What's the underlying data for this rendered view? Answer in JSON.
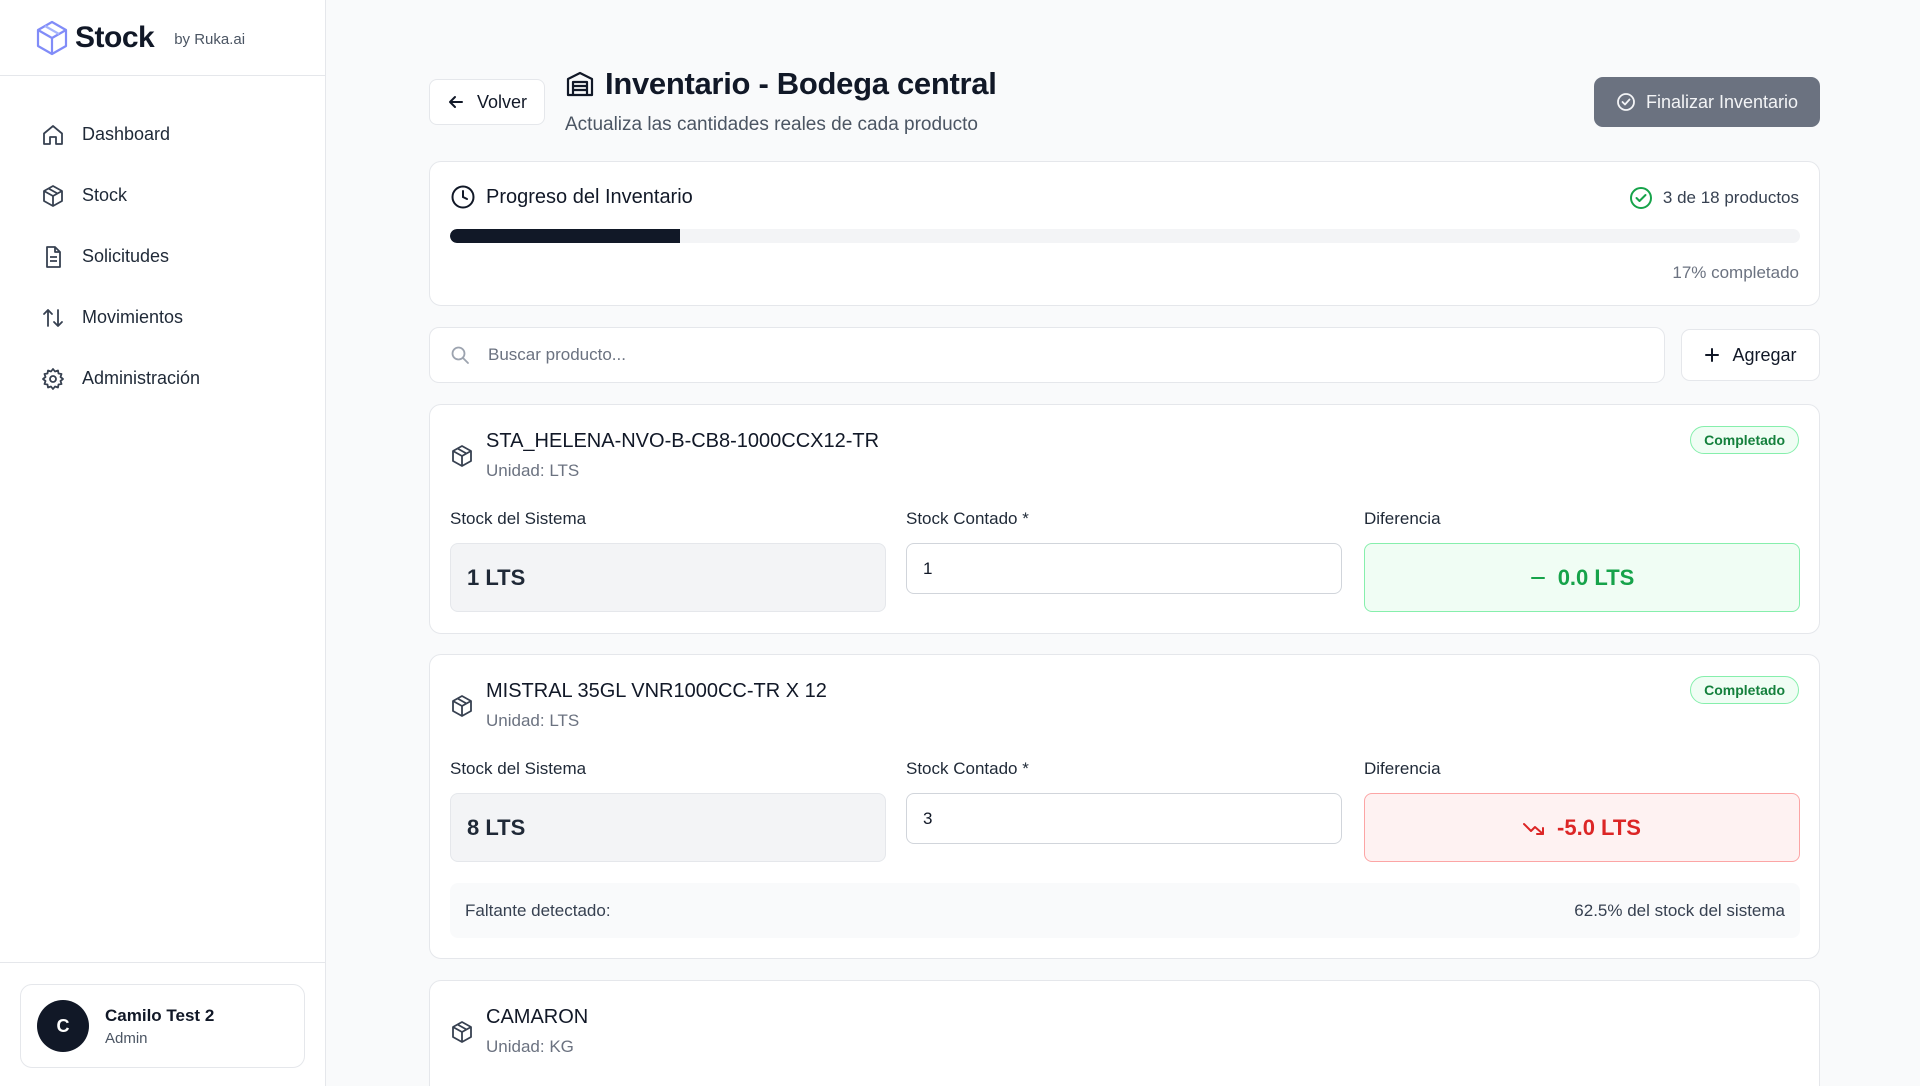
{
  "brand": {
    "name": "Stock",
    "by": "by Ruka.ai"
  },
  "sidebar": {
    "items": [
      {
        "label": "Dashboard",
        "icon": "home-icon"
      },
      {
        "label": "Stock",
        "icon": "box-icon"
      },
      {
        "label": "Solicitudes",
        "icon": "document-icon"
      },
      {
        "label": "Movimientos",
        "icon": "arrows-up-down-icon"
      },
      {
        "label": "Administración",
        "icon": "gear-icon"
      }
    ]
  },
  "user": {
    "initial": "C",
    "name": "Camilo Test 2",
    "role": "Admin"
  },
  "header": {
    "back_label": "Volver",
    "title": "Inventario - Bodega central",
    "subtitle": "Actualiza las cantidades reales de cada producto",
    "finish_label": "Finalizar Inventario"
  },
  "progress": {
    "title": "Progreso del Inventario",
    "count_text": "3 de 18 productos",
    "percent": 17,
    "percent_text": "17% completado"
  },
  "search": {
    "placeholder": "Buscar producto...",
    "add_label": "Agregar"
  },
  "labels": {
    "system": "Stock del Sistema",
    "counted": "Stock Contado *",
    "difference": "Diferencia"
  },
  "products": [
    {
      "name": "STA_HELENA-NVO-B-CB8-1000CCX12-TR",
      "unit": "Unidad: LTS",
      "badge": "Completado",
      "system_stock": "1 LTS",
      "counted": "1",
      "difference": "0.0 LTS",
      "status": "ok"
    },
    {
      "name": "MISTRAL 35GL VNR1000CC-TR X 12",
      "unit": "Unidad: LTS",
      "badge": "Completado",
      "system_stock": "8 LTS",
      "counted": "3",
      "difference": "-5.0 LTS",
      "status": "shortage",
      "shortage_label": "Faltante detectado:",
      "shortage_value": "62.5% del stock del sistema"
    },
    {
      "name": "CAMARON",
      "unit": "Unidad: KG"
    }
  ],
  "colors": {
    "accent": "#111827",
    "success": "#16a34a",
    "danger": "#dc2626",
    "muted_button": "#6b7280"
  }
}
